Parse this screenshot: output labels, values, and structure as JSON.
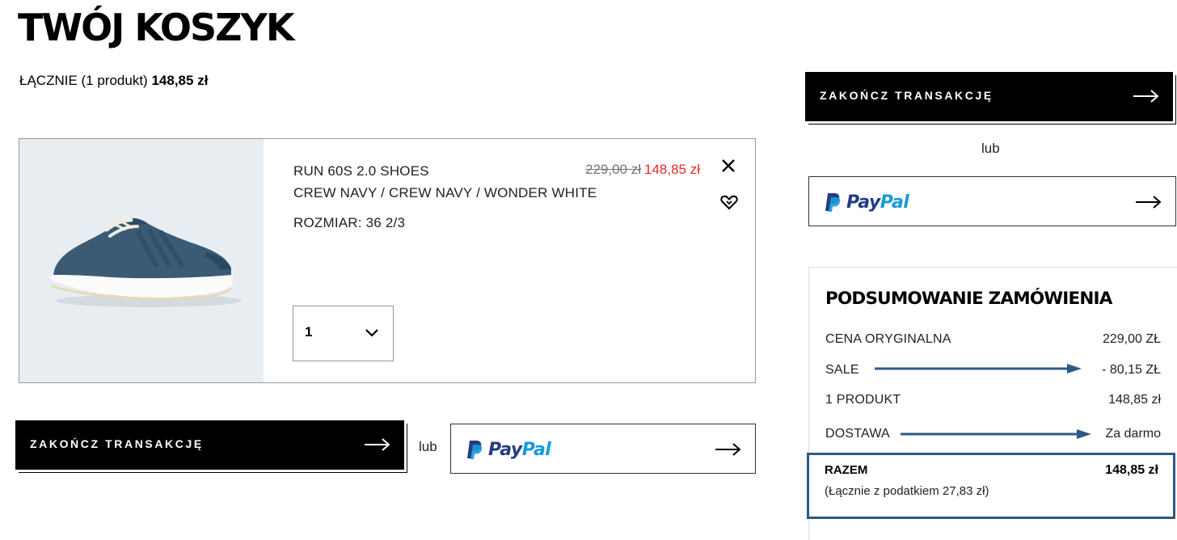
{
  "page": {
    "title": "TWÓJ KOSZYK",
    "total_label": "ŁĄCZNIE (1 produkt)",
    "total_amount": "148,85 zł"
  },
  "cart": {
    "items": [
      {
        "name": "RUN 60S 2.0 SHOES",
        "color": "CREW NAVY / CREW NAVY / WONDER WHITE",
        "size": "ROZMIAR: 36 2/3",
        "old_price": "229,00 zł",
        "price": "148,85 zł",
        "quantity": "1",
        "remove_icon": "close-icon",
        "wishlist_icon": "heart-icon"
      }
    ]
  },
  "actions": {
    "checkout_label": "ZAKOŃCZ TRANSAKCJĘ",
    "or_label": "lub",
    "paypal_pay": "Pay",
    "paypal_pal": "Pal"
  },
  "summary": {
    "title": "PODSUMOWANIE ZAMÓWIENIA",
    "rows": [
      {
        "label": "CENA ORYGINALNA",
        "value": "229,00 ZŁ"
      },
      {
        "label": "SALE",
        "value": "- 80,15 ZŁ"
      },
      {
        "label": "1 PRODUKT",
        "value": "148,85 zł"
      },
      {
        "label": "DOSTAWA",
        "value": "Za darmo"
      }
    ],
    "total_label": "RAZEM",
    "total_value": "148,85 zł",
    "tax_note": "(Łącznie z podatkiem  27,83 zł)"
  },
  "colors": {
    "sale_red": "#e32b2b",
    "annotation_blue": "#2d5a83",
    "paypal_dark": "#253b80",
    "paypal_light": "#179bd7"
  }
}
